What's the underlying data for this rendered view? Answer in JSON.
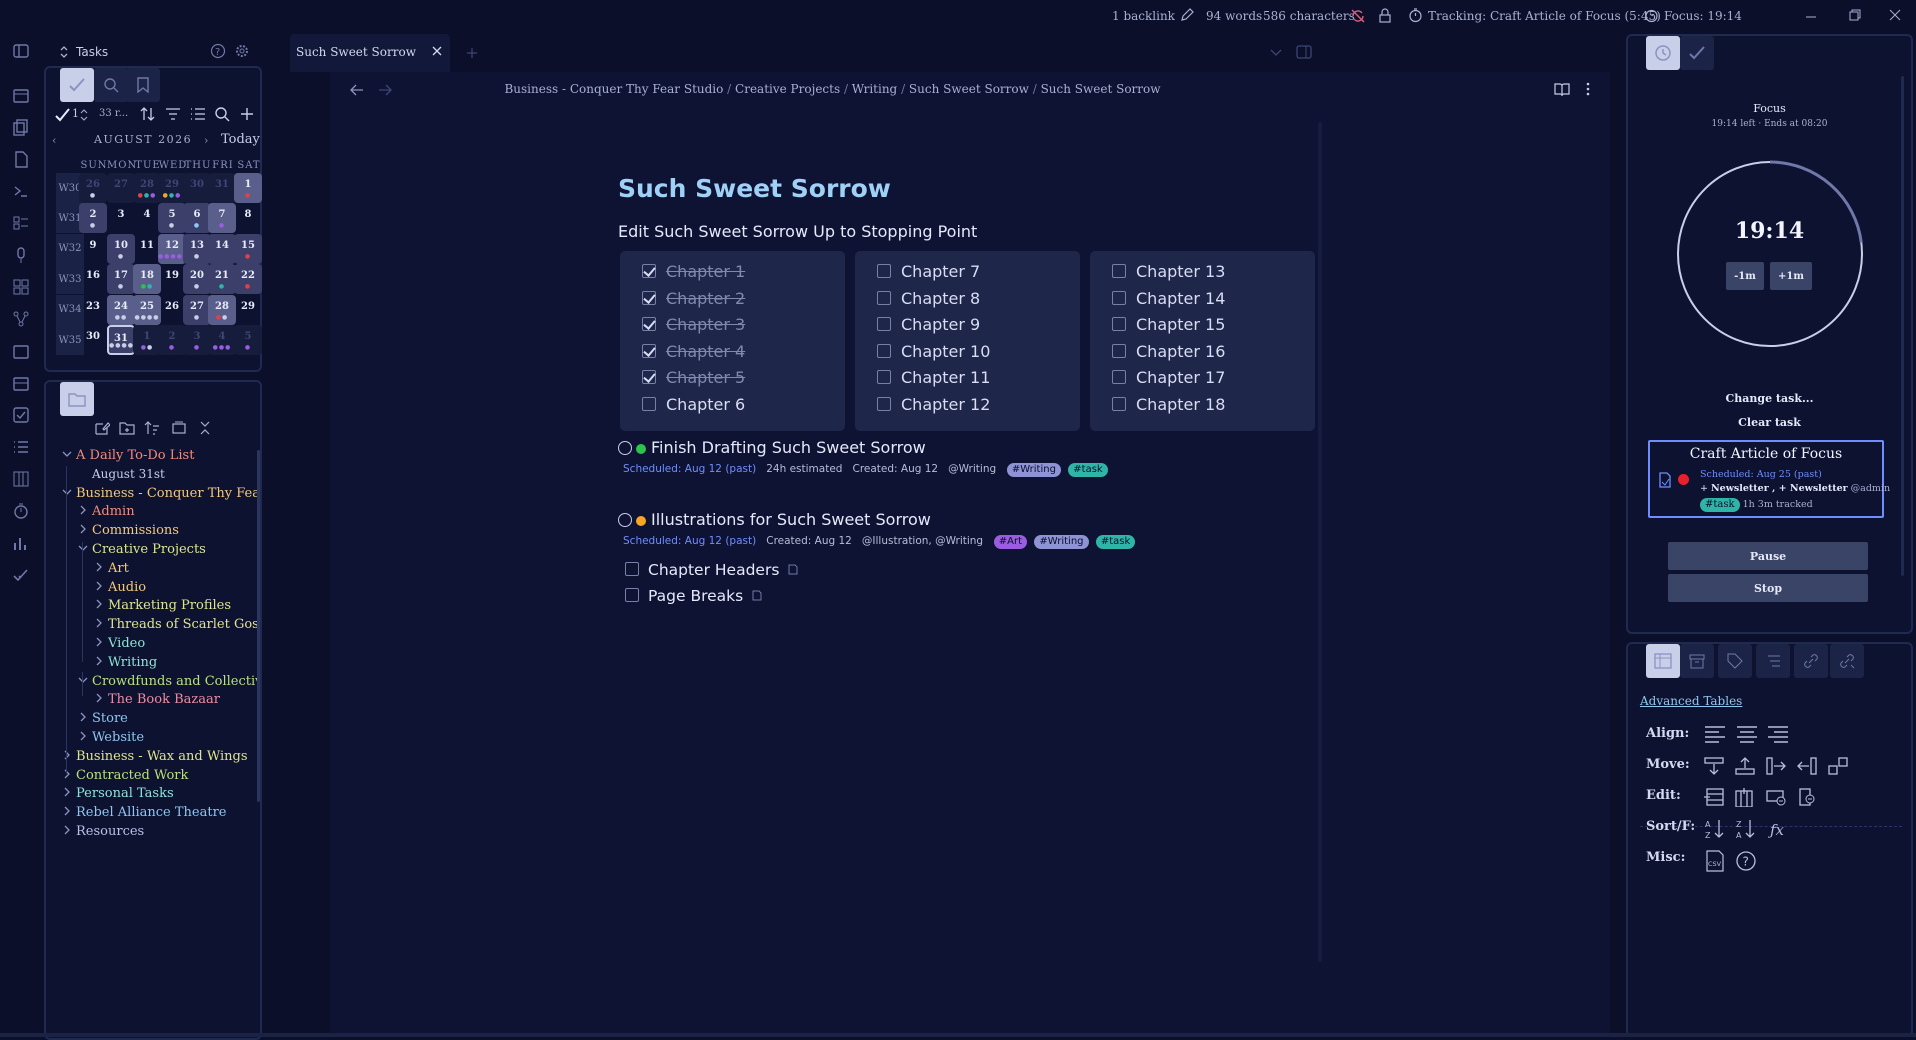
{
  "status_bar": {
    "backlinks": "1 backlink",
    "words": "94 words",
    "characters": "586 characters",
    "tracking": "Tracking: Craft Article of Focus (5:45)",
    "focus": "Focus: 19:14"
  },
  "left_top": {
    "title": "Tasks",
    "filter_count": "1",
    "task_count": "33 r..."
  },
  "calendar": {
    "month": "AUGUST 2026",
    "today_label": "Today",
    "weekdays": [
      "SUN",
      "MON",
      "TUE",
      "WED",
      "THU",
      "FRI",
      "SAT"
    ],
    "weeks": [
      "W30",
      "W31",
      "W32",
      "W33",
      "W34",
      "W35"
    ],
    "days": [
      [
        "26",
        "27",
        "28",
        "29",
        "30",
        "31",
        "1"
      ],
      [
        "2",
        "3",
        "4",
        "5",
        "6",
        "7",
        "8"
      ],
      [
        "9",
        "10",
        "11",
        "12",
        "13",
        "14",
        "15"
      ],
      [
        "16",
        "17",
        "18",
        "19",
        "20",
        "21",
        "22"
      ],
      [
        "23",
        "24",
        "25",
        "26",
        "27",
        "28",
        "29"
      ],
      [
        "30",
        "31",
        "1",
        "2",
        "3",
        "4",
        "5"
      ]
    ]
  },
  "file_tree": [
    {
      "label": "A Daily To-Do List",
      "color": "#f08c7c"
    },
    {
      "label": "August 31st",
      "color": "#c8cde8"
    },
    {
      "label": "Business - Conquer Thy Fear Stu...",
      "color": "#f3c97a"
    },
    {
      "label": "Admin",
      "color": "#f08c7c"
    },
    {
      "label": "Commissions",
      "color": "#f3c97a"
    },
    {
      "label": "Creative Projects",
      "color": "#dfe58a"
    },
    {
      "label": "Art",
      "color": "#f3c97a"
    },
    {
      "label": "Audio",
      "color": "#f3c97a"
    },
    {
      "label": "Marketing Profiles",
      "color": "#dfe58a"
    },
    {
      "label": "Threads of Scarlet Gossa...",
      "color": "#dfe58a"
    },
    {
      "label": "Video",
      "color": "#8fe3d6"
    },
    {
      "label": "Writing",
      "color": "#8fe3d6"
    },
    {
      "label": "Crowdfunds and Collectives",
      "color": "#b9e07a"
    },
    {
      "label": "The Book Bazaar",
      "color": "#f08ca0"
    },
    {
      "label": "Store",
      "color": "#8fc7f0"
    },
    {
      "label": "Website",
      "color": "#8fc7f0"
    },
    {
      "label": "Business - Wax and Wings",
      "color": "#dfe58a"
    },
    {
      "label": "Contracted Work",
      "color": "#b9e07a"
    },
    {
      "label": "Personal Tasks",
      "color": "#8fe3d6"
    },
    {
      "label": "Rebel Alliance Theatre",
      "color": "#8fc7f0"
    },
    {
      "label": "Resources",
      "color": "#b9c0e8"
    }
  ],
  "tab": {
    "title": "Such Sweet Sorrow"
  },
  "breadcrumb": [
    "Business - Conquer Thy Fear Studio",
    "Creative Projects",
    "Writing",
    "Such Sweet Sorrow",
    "Such Sweet Sorrow"
  ],
  "doc": {
    "title": "Such Sweet Sorrow",
    "subtitle": "Edit Such Sweet Sorrow Up to Stopping Point",
    "chapters": [
      [
        {
          "t": "Chapter 1",
          "done": true
        },
        {
          "t": "Chapter 2",
          "done": true
        },
        {
          "t": "Chapter 3",
          "done": true
        },
        {
          "t": "Chapter 4",
          "done": true
        },
        {
          "t": "Chapter 5",
          "done": true
        },
        {
          "t": "Chapter 6",
          "done": false
        }
      ],
      [
        {
          "t": "Chapter 7",
          "done": false
        },
        {
          "t": "Chapter 8",
          "done": false
        },
        {
          "t": "Chapter 9",
          "done": false
        },
        {
          "t": "Chapter 10",
          "done": false
        },
        {
          "t": "Chapter 11",
          "done": false
        },
        {
          "t": "Chapter 12",
          "done": false
        }
      ],
      [
        {
          "t": "Chapter 13",
          "done": false
        },
        {
          "t": "Chapter 14",
          "done": false
        },
        {
          "t": "Chapter 15",
          "done": false
        },
        {
          "t": "Chapter 16",
          "done": false
        },
        {
          "t": "Chapter 17",
          "done": false
        },
        {
          "t": "Chapter 18",
          "done": false
        }
      ]
    ],
    "task1": {
      "title": "Finish Drafting Such Sweet Sorrow",
      "scheduled": "Scheduled: Aug 12 (past)",
      "estimate": "24h estimated",
      "created": "Created: Aug 12",
      "context": "@Writing",
      "tags": [
        "#Writing",
        "#task"
      ]
    },
    "task2": {
      "title": "Illustrations for Such Sweet Sorrow",
      "scheduled": "Scheduled: Aug 12 (past)",
      "created": "Created: Aug 12",
      "context": "@Illustration, @Writing",
      "tags": [
        "#Art",
        "#Writing",
        "#task"
      ],
      "subtasks": [
        "Chapter Headers",
        "Page Breaks"
      ]
    }
  },
  "focus": {
    "title": "Focus",
    "sub": "19:14 left · Ends at 08:20",
    "time": "19:14",
    "progress": 0.23,
    "minus": "-1m",
    "plus": "+1m",
    "change": "Change task...",
    "clear": "Clear task",
    "card_title": "Craft Article of Focus",
    "card_scheduled": "Scheduled: Aug 25 (past)",
    "card_projects": "Newsletter , + Newsletter",
    "card_context": "@admin",
    "card_tag": "#task",
    "card_tracked": "1h 3m tracked",
    "pause": "Pause",
    "stop": "Stop"
  },
  "adv_tables": {
    "title": "Advanced Tables",
    "rows": [
      "Align:",
      "Move:",
      "Edit:",
      "Sort/F:",
      "Misc:"
    ]
  }
}
